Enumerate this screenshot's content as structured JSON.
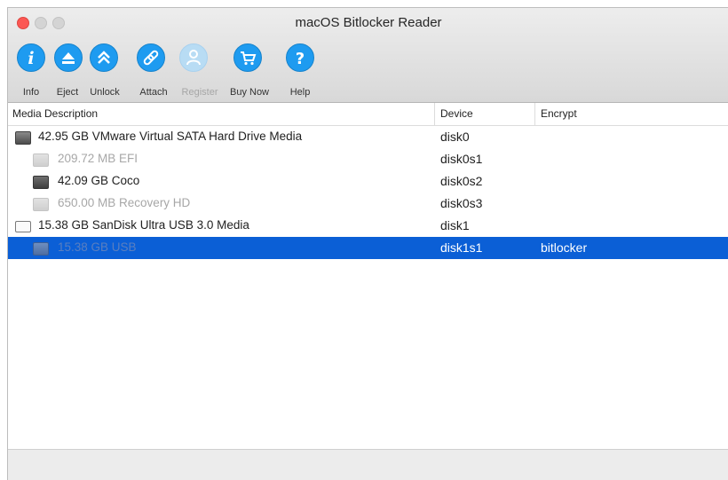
{
  "window": {
    "title": "macOS Bitlocker Reader"
  },
  "toolbar": {
    "info_label": "Info",
    "eject_label": "Eject",
    "unlock_label": "Unlock",
    "attach_label": "Attach",
    "register_label": "Register",
    "buy_now_label": "Buy Now",
    "help_label": "Help"
  },
  "table": {
    "columns": [
      "Media Description",
      "Device",
      "Encrypt"
    ],
    "rows": [
      {
        "description": "42.95 GB VMware Virtual SATA Hard Drive Media",
        "device": "disk0",
        "encrypt": "",
        "icon": "hard-drive-icon",
        "dimmed": false,
        "selected": false
      },
      {
        "description": "209.72 MB EFI",
        "device": "disk0s1",
        "encrypt": "",
        "icon": "partition-icon",
        "dimmed": true,
        "selected": false
      },
      {
        "description": "42.09 GB Coco",
        "device": "disk0s2",
        "encrypt": "",
        "icon": "partition-icon",
        "dimmed": false,
        "selected": false
      },
      {
        "description": "650.00 MB Recovery HD",
        "device": "disk0s3",
        "encrypt": "",
        "icon": "partition-icon",
        "dimmed": true,
        "selected": false
      },
      {
        "description": "15.38 GB SanDisk Ultra USB 3.0 Media",
        "device": "disk1",
        "encrypt": "",
        "icon": "usb-drive-icon",
        "dimmed": false,
        "selected": false
      },
      {
        "description": "15.38 GB USB",
        "device": "disk1s1",
        "encrypt": "bitlocker",
        "icon": "partition-icon",
        "dimmed": true,
        "selected": true
      }
    ]
  },
  "colors": {
    "accent": "#1e9bf0",
    "selection": "#0b5fd6",
    "close": "#fc5753"
  }
}
